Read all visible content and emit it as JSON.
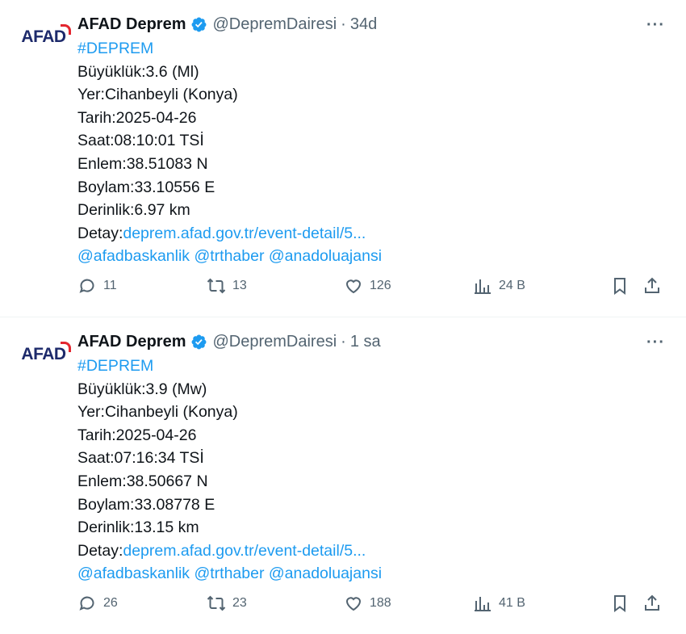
{
  "tweets": [
    {
      "avatar_text": "AFAD",
      "name": "AFAD Deprem",
      "handle": "@DepremDairesi",
      "time": "34d",
      "more": "···",
      "hashtag": "#DEPREM",
      "lines": [
        "Büyüklük:3.6 (Ml)",
        "Yer:Cihanbeyli (Konya)",
        "Tarih:2025-04-26",
        "Saat:08:10:01 TSİ",
        "Enlem:38.51083 N",
        "Boylam:33.10556 E",
        "Derinlik:6.97 km"
      ],
      "detail_label": "Detay:",
      "detail_link": "deprem.afad.gov.tr/event-detail/5...",
      "mentions": "@afadbaskanlik @trthaber @anadoluajansi",
      "replies": "11",
      "retweets": "13",
      "likes": "126",
      "views": "24 B"
    },
    {
      "avatar_text": "AFAD",
      "name": "AFAD Deprem",
      "handle": "@DepremDairesi",
      "time": "1 sa",
      "more": "···",
      "hashtag": "#DEPREM",
      "lines": [
        "Büyüklük:3.9 (Mw)",
        "Yer:Cihanbeyli (Konya)",
        "Tarih:2025-04-26",
        "Saat:07:16:34 TSİ",
        "Enlem:38.50667 N",
        "Boylam:33.08778 E",
        "Derinlik:13.15 km"
      ],
      "detail_label": "Detay:",
      "detail_link": "deprem.afad.gov.tr/event-detail/5...",
      "mentions": "@afadbaskanlik @trthaber @anadoluajansi",
      "replies": "26",
      "retweets": "23",
      "likes": "188",
      "views": "41 B"
    }
  ],
  "colors": {
    "accent": "#1d9bf0",
    "muted": "#536471",
    "text": "#0f1419",
    "logo_blue": "#1d2a6b",
    "logo_red": "#e3262f"
  }
}
